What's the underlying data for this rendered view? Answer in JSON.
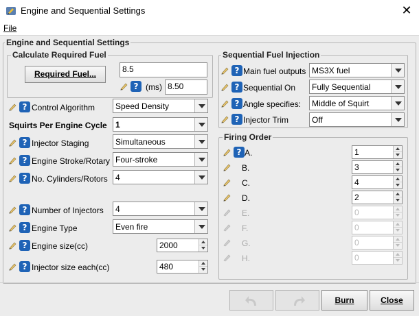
{
  "window": {
    "title": "Engine and Sequential Settings",
    "menu_file": "File"
  },
  "panel": {
    "title": "Engine and Sequential Settings"
  },
  "required_fuel": {
    "group_title": "Calculate Required Fuel",
    "button_label": "Required Fuel...",
    "value": "8.5",
    "ms_label": "(ms)",
    "ms_value": "8.50"
  },
  "left": {
    "control_algorithm": {
      "label": "Control Algorithm",
      "value": "Speed Density"
    },
    "squirts": {
      "label": "Squirts Per Engine Cycle",
      "value": "1"
    },
    "injector_staging": {
      "label": "Injector Staging",
      "value": "Simultaneous"
    },
    "engine_stroke": {
      "label": "Engine Stroke/Rotary",
      "value": "Four-stroke"
    },
    "no_cylinders": {
      "label": "No. Cylinders/Rotors",
      "value": "4"
    },
    "num_injectors": {
      "label": "Number of Injectors",
      "value": "4"
    },
    "engine_type": {
      "label": "Engine Type",
      "value": "Even fire"
    },
    "engine_size": {
      "label": "Engine size(cc)",
      "value": "2000"
    },
    "injector_size": {
      "label": "Injector size each(cc)",
      "value": "480"
    }
  },
  "sequential": {
    "group_title": "Sequential Fuel Injection",
    "main_fuel_outputs": {
      "label": "Main fuel outputs",
      "value": "MS3X fuel"
    },
    "sequential_on": {
      "label": "Sequential On",
      "value": "Fully Sequential"
    },
    "angle_specifies": {
      "label": "Angle specifies:",
      "value": "Middle of Squirt"
    },
    "injector_trim": {
      "label": "Injector Trim",
      "value": "Off"
    }
  },
  "firing_order": {
    "group_title": "Firing Order",
    "rows": [
      {
        "label": "A.",
        "value": "1"
      },
      {
        "label": "B.",
        "value": "3"
      },
      {
        "label": "C.",
        "value": "4"
      },
      {
        "label": "D.",
        "value": "2"
      },
      {
        "label": "E.",
        "value": "0"
      },
      {
        "label": "F.",
        "value": "0"
      },
      {
        "label": "G.",
        "value": "0"
      },
      {
        "label": "H.",
        "value": "0"
      }
    ]
  },
  "footer": {
    "burn_label": "Burn",
    "close_label": "Close"
  },
  "icons": {
    "app": "settings-app-icon",
    "pencil": "pencil-icon",
    "help": "help-icon",
    "undo": "undo-icon",
    "redo": "redo-icon"
  },
  "colors": {
    "help_blue": "#1f63b6",
    "panel_bg": "#ececec"
  }
}
